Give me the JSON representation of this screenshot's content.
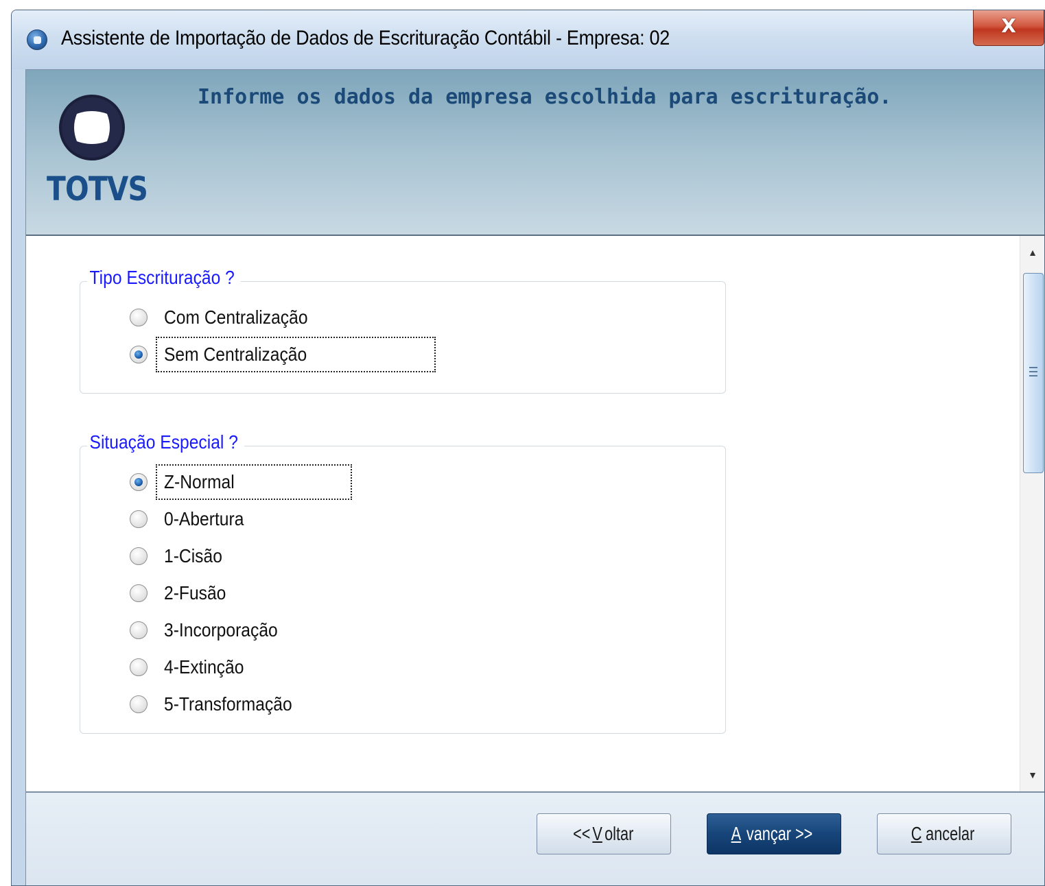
{
  "window": {
    "title": "Assistente de Importação de Dados de Escrituração Contábil - Empresa: 02",
    "close_label": "X"
  },
  "banner": {
    "message": "Informe os dados da empresa escolhida para escrituração.",
    "logo_text": "TOTVS"
  },
  "tipo_escrituracao": {
    "legend": "Tipo Escrituração ?",
    "options": [
      "Com Centralização",
      "Sem Centralização"
    ],
    "selected": "Sem Centralização"
  },
  "situacao_especial": {
    "legend": "Situação Especial ?",
    "options": [
      "Z-Normal",
      "0-Abertura",
      "1-Cisão",
      "2-Fusão",
      "3-Incorporação",
      "4-Extinção",
      "5-Transformação"
    ],
    "selected": "Z-Normal"
  },
  "buttons": {
    "back": {
      "prefix": "<< ",
      "mnemonic": "V",
      "rest": "oltar"
    },
    "next": {
      "mnemonic": "A",
      "rest": "vançar >>"
    },
    "cancel": {
      "mnemonic": "C",
      "rest": "ancelar"
    }
  },
  "icons": {
    "app": "app-icon",
    "close": "close-icon",
    "logo": "totvs-logo-icon",
    "scroll_up": "scroll-up-icon",
    "scroll_down": "scroll-down-icon"
  },
  "colors": {
    "legend": "#1a1aff",
    "banner_text": "#1c4a78",
    "primary_button": "#17457a",
    "logo": "#1a4f8a"
  }
}
